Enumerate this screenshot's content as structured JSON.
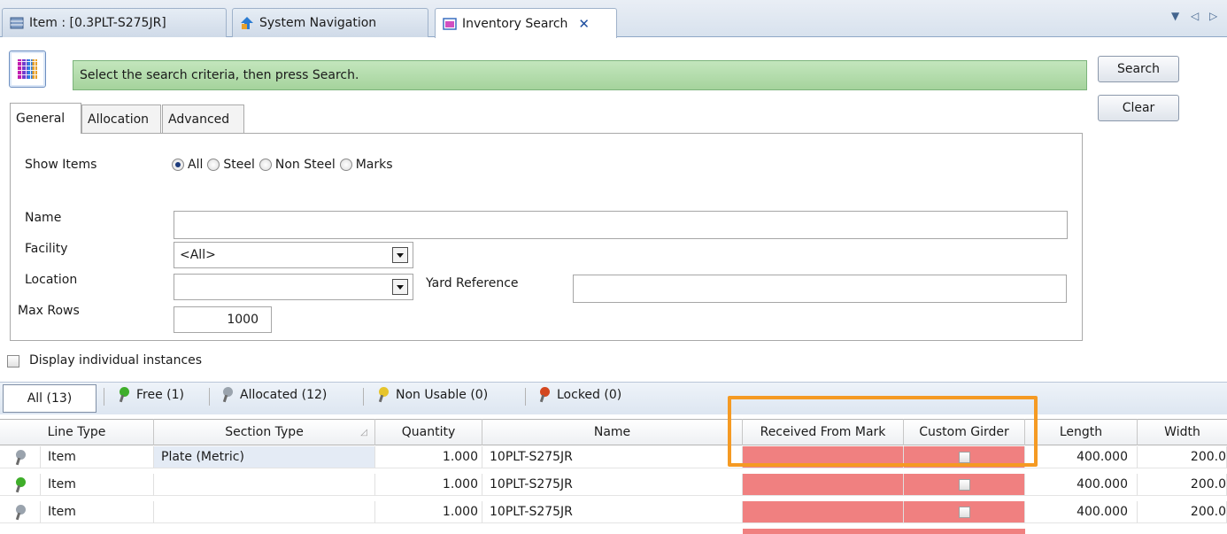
{
  "doc_tabs": [
    {
      "label": "Item : [0.3PLT-S275JR]",
      "icon": "table-icon"
    },
    {
      "label": "System Navigation",
      "icon": "navigation-arrow-icon"
    },
    {
      "label": "Inventory Search",
      "icon": "window-icon",
      "active": true
    }
  ],
  "strip_controls": {
    "dropdown": "▼",
    "left": "◁",
    "right": "▷"
  },
  "header": {
    "instruction": "Select the search criteria, then press Search.",
    "search_label": "Search",
    "clear_label": "Clear"
  },
  "criteria_tabs": [
    "General",
    "Allocation",
    "Advanced"
  ],
  "general": {
    "show_items_label": "Show Items",
    "show_items_options": [
      "All",
      "Steel",
      "Non Steel",
      "Marks"
    ],
    "show_items_selected": "All",
    "name_label": "Name",
    "name_value": "",
    "facility_label": "Facility",
    "facility_value": "<All>",
    "location_label": "Location",
    "location_value": "",
    "yard_reference_label": "Yard Reference",
    "yard_reference_value": "",
    "max_rows_label": "Max Rows",
    "max_rows_value": "1000"
  },
  "display_instances_label": "Display individual instances",
  "filters": {
    "all": "All (13)",
    "free": "Free (1)",
    "allocated": "Allocated (12)",
    "non_usable": "Non Usable (0)",
    "locked": "Locked (0)"
  },
  "colors": {
    "free_pin": "#3fae2a",
    "allocated_pin": "#9aa3ad",
    "non_usable_pin": "#e6c42b",
    "locked_pin": "#d4471f",
    "highlight": "#f59a23",
    "highlight_fill": "#f08080"
  },
  "grid": {
    "columns": [
      "Line Type",
      "Section Type",
      "Quantity",
      "Name",
      "Received From Mark",
      "Custom Girder",
      "Length",
      "Width"
    ],
    "rows": [
      {
        "status": "allocated",
        "line_type": "Item",
        "section_type": "Plate (Metric)",
        "quantity": "1.000",
        "name": "10PLT-S275JR",
        "received_from_mark": "",
        "custom_girder": false,
        "length": "400.000",
        "width": "200.0"
      },
      {
        "status": "free",
        "line_type": "Item",
        "section_type": "",
        "quantity": "1.000",
        "name": "10PLT-S275JR",
        "received_from_mark": "",
        "custom_girder": false,
        "length": "400.000",
        "width": "200.0"
      },
      {
        "status": "allocated",
        "line_type": "Item",
        "section_type": "",
        "quantity": "1.000",
        "name": "10PLT-S275JR",
        "received_from_mark": "",
        "custom_girder": false,
        "length": "400.000",
        "width": "200.0"
      }
    ]
  }
}
